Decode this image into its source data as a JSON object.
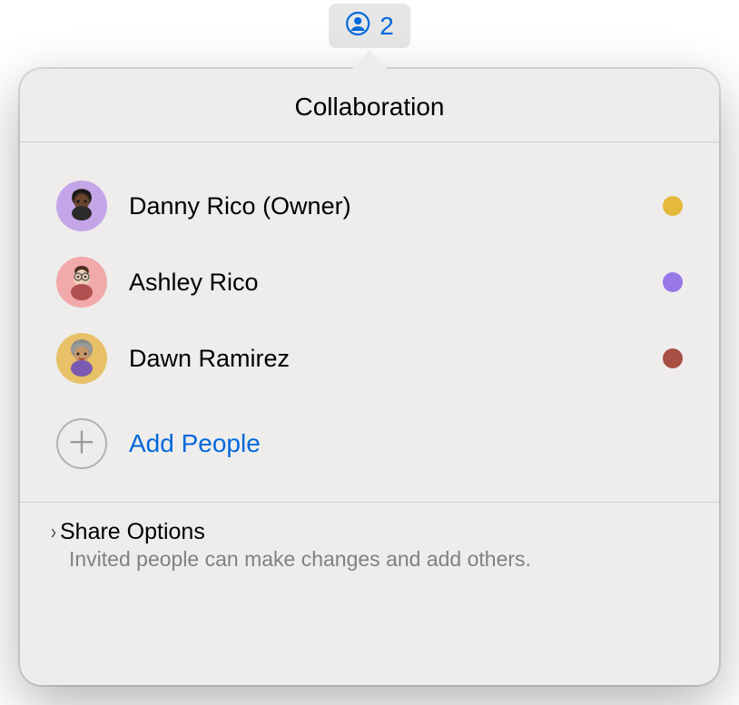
{
  "toolbar": {
    "count": "2"
  },
  "popover": {
    "title": "Collaboration"
  },
  "participants": [
    {
      "name": "Danny Rico (Owner)",
      "status_color": "#e5b93c"
    },
    {
      "name": "Ashley Rico",
      "status_color": "#9877e8"
    },
    {
      "name": "Dawn Ramirez",
      "status_color": "#a84f44"
    }
  ],
  "add_people": {
    "label": "Add People"
  },
  "share_options": {
    "title": "Share Options",
    "subtitle": "Invited people can make changes and add others."
  }
}
